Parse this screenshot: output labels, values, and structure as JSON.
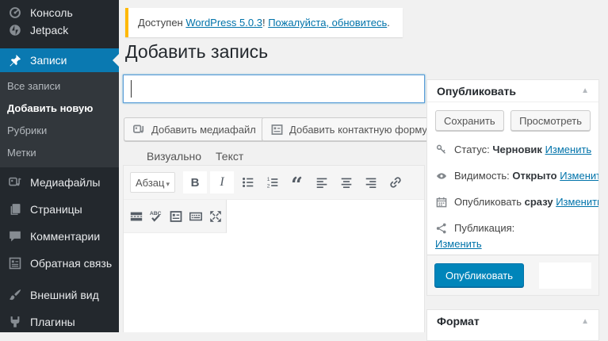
{
  "page_title": "Добавить запись",
  "colors": {
    "sidebar_bg": "#23282d",
    "submenu_bg": "#32373c",
    "menu_active_bg": "#0a79b1",
    "accent_link": "#0073aa",
    "notice_border": "#ffb900",
    "primary_button_bg": "#0085ba",
    "page_bg": "#f1f1f1"
  },
  "sidebar": {
    "items": [
      {
        "label": "Консоль",
        "icon": "dashboard-icon"
      },
      {
        "label": "Jetpack",
        "icon": "jetpack-icon"
      },
      {
        "label": "Записи",
        "icon": "pin-icon",
        "active": true
      },
      {
        "label": "Медиафайлы",
        "icon": "media-icon"
      },
      {
        "label": "Страницы",
        "icon": "pages-icon"
      },
      {
        "label": "Комментарии",
        "icon": "comments-icon"
      },
      {
        "label": "Обратная связь",
        "icon": "feedback-icon"
      },
      {
        "label": "Внешний вид",
        "icon": "appearance-icon"
      },
      {
        "label": "Плагины",
        "icon": "plugins-icon"
      }
    ],
    "posts_submenu": [
      {
        "label": "Все записи"
      },
      {
        "label": "Добавить новую",
        "active": true
      },
      {
        "label": "Рубрики"
      },
      {
        "label": "Метки"
      }
    ]
  },
  "notice": {
    "text_before": "Доступен",
    "update_link": "WordPress 5.0.3",
    "exclamation": "!",
    "please_update_link": "Пожалуйста, обновитесь",
    "period": "."
  },
  "editor": {
    "title_value": "",
    "add_media_button": "Добавить медиафайл",
    "add_contact_form_button": "Добавить контактную форму",
    "tabs": [
      {
        "label": "Визуально"
      },
      {
        "label": "Текст"
      }
    ],
    "toolbar": {
      "paragraph_label": "Абзац",
      "bold_label": "B",
      "italic_label": "I",
      "row1_icons": [
        "paragraph-dropdown",
        "bold",
        "italic",
        "bullet-list",
        "numbered-list",
        "blockquote",
        "align-left",
        "align-center",
        "align-right",
        "link"
      ],
      "row2_icons": [
        "read-more",
        "spellcheck",
        "contact-form",
        "toolbar-toggle",
        "fullscreen"
      ]
    }
  },
  "publish_panel": {
    "title": "Опубликовать",
    "save_button": "Сохранить",
    "preview_button": "Просмотреть",
    "rows": [
      {
        "icon": "key-icon",
        "label": "Статус:",
        "value": "Черновик",
        "link": "Изменить"
      },
      {
        "icon": "eye-icon",
        "label": "Видимость:",
        "value": "Открыто",
        "link": "Изменить"
      },
      {
        "icon": "calendar-icon",
        "label": "Опубликовать",
        "value": "сразу",
        "link": "Изменить"
      }
    ],
    "publicize": {
      "icon": "share-icon",
      "label": "Публикация:",
      "link": "Изменить"
    },
    "publish_button": "Опубликовать"
  },
  "format_panel": {
    "title": "Формат"
  }
}
